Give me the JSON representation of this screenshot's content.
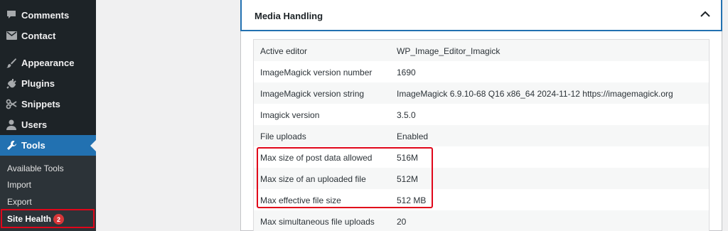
{
  "sidebar": {
    "items": [
      {
        "label": "Comments",
        "icon": "comment-icon"
      },
      {
        "label": "Contact",
        "icon": "envelope-icon"
      },
      {
        "label": "Appearance",
        "icon": "paintbrush-icon"
      },
      {
        "label": "Plugins",
        "icon": "plug-icon"
      },
      {
        "label": "Snippets",
        "icon": "scissors-icon"
      },
      {
        "label": "Users",
        "icon": "user-icon"
      },
      {
        "label": "Tools",
        "icon": "wrench-icon"
      }
    ],
    "submenu": [
      "Available Tools",
      "Import",
      "Export",
      "Site Health"
    ],
    "badge": "2",
    "colors": {
      "bg": "#1d2327",
      "active": "#2271b1",
      "highlight": "#e0061a"
    }
  },
  "section": {
    "title": "Media Handling"
  },
  "rows": [
    {
      "key": "Active editor",
      "value": "WP_Image_Editor_Imagick"
    },
    {
      "key": "ImageMagick version number",
      "value": "1690"
    },
    {
      "key": "ImageMagick version string",
      "value": "ImageMagick 6.9.10-68 Q16 x86_64 2024-11-12 https://imagemagick.org"
    },
    {
      "key": "Imagick version",
      "value": "3.5.0"
    },
    {
      "key": "File uploads",
      "value": "Enabled"
    },
    {
      "key": "Max size of post data allowed",
      "value": "516M"
    },
    {
      "key": "Max size of an uploaded file",
      "value": "512M"
    },
    {
      "key": "Max effective file size",
      "value": "512 MB"
    },
    {
      "key": "Max simultaneous file uploads",
      "value": "20"
    }
  ]
}
